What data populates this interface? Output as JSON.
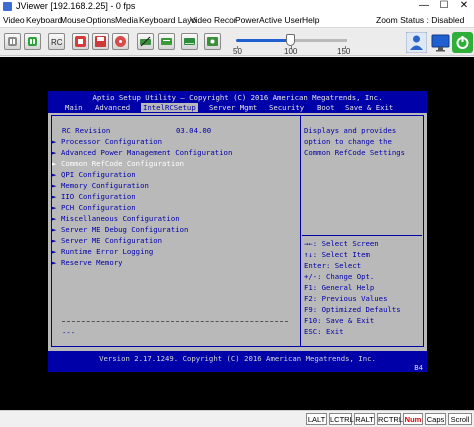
{
  "window": {
    "title": "JViewer [192.168.2.25] - 0 fps",
    "controls": [
      "—",
      "☐",
      "✕"
    ]
  },
  "menu": {
    "items": [
      "Video",
      "Keyboard",
      "Mouse",
      "Options",
      "Media",
      "Keyboard Layo",
      "Video Recor",
      "Power",
      "Active User",
      "Help"
    ],
    "zoom_status": "Zoom Status : Disabled"
  },
  "toolbar": {
    "buttons": [
      "pause-video",
      "resume-video",
      "full-keyboard-ctrl",
      "record-video",
      "stop-record",
      "cd-media",
      "mouse-sync",
      "keyboard-layout",
      "hotkeys",
      "power-off",
      "power-on"
    ],
    "slider": {
      "min": "50",
      "mid": "100",
      "max": "150",
      "value": 100
    },
    "right_buttons": [
      "active-users",
      "display-monitor",
      "power-status"
    ]
  },
  "bios": {
    "title": "Aptio Setup Utility – Copyright (C) 2016 American Megatrends, Inc.",
    "tabs": [
      "Main",
      "Advanced",
      "IntelRCSetup",
      "Server Mgmt",
      "Security",
      "Boot",
      "Save & Exit"
    ],
    "active_tab": "IntelRCSetup",
    "revision_label": "RC Revision",
    "revision_value": "03.04.00",
    "menu_items": [
      "Processor Configuration",
      "Advanced Power Management Configuration",
      "Common RefCode Configuration",
      "QPI Configuration",
      "Memory Configuration",
      "IIO Configuration",
      "PCH Configuration",
      "Miscellaneous Configuration",
      "Server ME Debug Configuration",
      "Server ME Configuration",
      "Runtime Error Logging",
      "Reserve Memory"
    ],
    "selected_item": "Common RefCode Configuration",
    "help_text": [
      "Displays and provides",
      "option to change the",
      "Common RefCode Settings"
    ],
    "key_help": [
      "→←: Select Screen",
      "↑↓: Select Item",
      "Enter: Select",
      "+/-: Change Opt.",
      "F1: General Help",
      "F2: Previous Values",
      "F9: Optimized Defaults",
      "F10: Save & Exit",
      "ESC: Exit"
    ],
    "bottom_dashes": "---",
    "version": "Version 2.17.1249. Copyright (C) 2016 American Megatrends, Inc.",
    "code": "B4"
  },
  "statusbar": {
    "keys": [
      "LALT",
      "LCTRL",
      "RALT",
      "RCTRL",
      "Num",
      "Caps",
      "Scroll"
    ],
    "active_keys": [
      "Num"
    ]
  },
  "colors": {
    "bios_blue": "#0000a8",
    "bios_gray": "#b9b9b9",
    "slider_blue": "#1f5fd0",
    "key_active": "#e00000"
  }
}
